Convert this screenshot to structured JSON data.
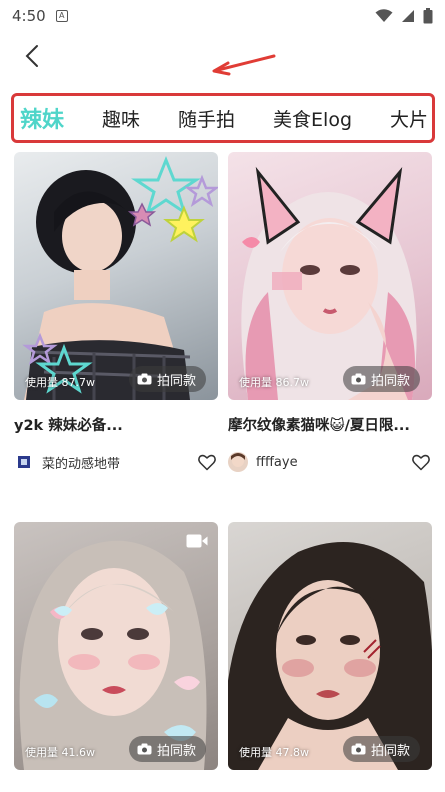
{
  "status_bar": {
    "time": "4:50",
    "a_glyph": "A",
    "icons": [
      "wifi-icon",
      "signal-icon",
      "battery-icon"
    ]
  },
  "header": {
    "back_icon": "back-chevron-icon",
    "arrow_icon": "red-arrow-annotation-icon",
    "arrow_color": "#e03c35"
  },
  "tabs": {
    "items": [
      {
        "label": "辣妹",
        "active": true
      },
      {
        "label": "趣味",
        "active": false
      },
      {
        "label": "随手拍",
        "active": false
      },
      {
        "label": "美食Elog",
        "active": false
      },
      {
        "label": "大片",
        "active": false
      }
    ],
    "active_color": "#4fd5c9",
    "highlight_border_color": "#d9393a"
  },
  "cards": [
    {
      "usage": "使用量 87.7w",
      "button": "拍同款",
      "title": "y2k 辣妹必备...",
      "author": "菜的动感地带",
      "has_video": false
    },
    {
      "usage": "使用量 86.7w",
      "button": "拍同款",
      "title": "摩尔纹像素猫咪😺/夏日限...",
      "author": "ffffaye",
      "has_video": false
    },
    {
      "usage": "使用量 41.6w",
      "button": "拍同款",
      "title": "",
      "author": "",
      "has_video": true
    },
    {
      "usage": "使用量 47.8w",
      "button": "拍同款",
      "title": "",
      "author": "",
      "has_video": false
    }
  ]
}
